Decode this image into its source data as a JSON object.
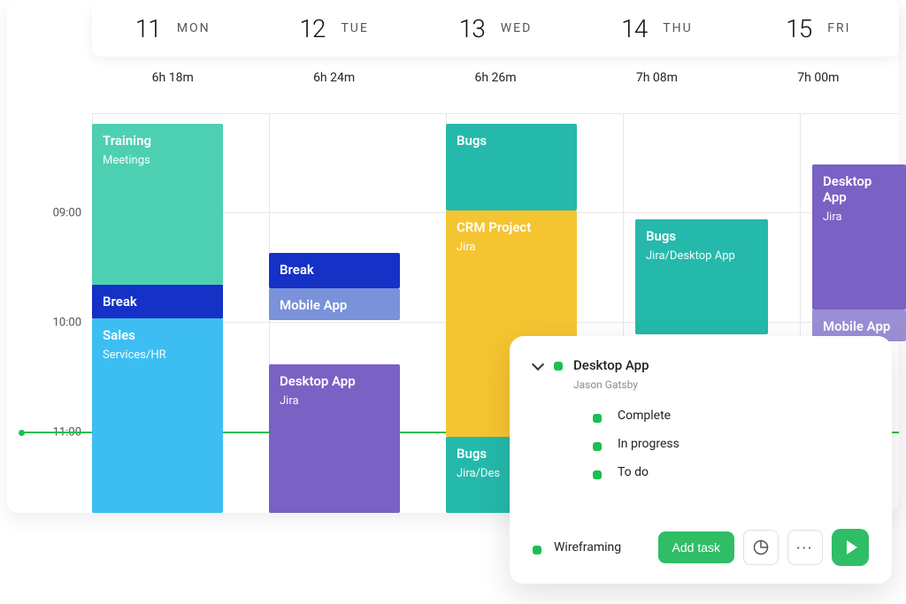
{
  "days": [
    {
      "num": "11",
      "dow": "MON",
      "duration": "6h 18m"
    },
    {
      "num": "12",
      "dow": "TUE",
      "duration": "6h 24m"
    },
    {
      "num": "13",
      "dow": "WED",
      "duration": "6h 26m"
    },
    {
      "num": "14",
      "dow": "THU",
      "duration": "7h 08m"
    },
    {
      "num": "15",
      "dow": "FRI",
      "duration": "7h 00m"
    }
  ],
  "time_labels": {
    "t0900": "09:00",
    "t1000": "10:00",
    "t1100": "11:00"
  },
  "events": {
    "mon_training": {
      "title": "Training",
      "sub": "Meetings"
    },
    "mon_break": {
      "title": "Break"
    },
    "mon_sales": {
      "title": "Sales",
      "sub": "Services/HR"
    },
    "tue_break": {
      "title": "Break"
    },
    "tue_mobile": {
      "title": "Mobile App"
    },
    "tue_desktop": {
      "title": "Desktop App",
      "sub": "Jira"
    },
    "wed_bugs": {
      "title": "Bugs"
    },
    "wed_crm": {
      "title": "CRM Project",
      "sub": "Jira"
    },
    "wed_bugs2": {
      "title": "Bugs",
      "sub": "Jira/Des"
    },
    "thu_bugs": {
      "title": "Bugs",
      "sub": "Jira/Desktop App"
    },
    "fri_desktop": {
      "title": "Desktop App",
      "sub": "Jira"
    },
    "fri_mobile": {
      "title": "Mobile App"
    }
  },
  "popover": {
    "title": "Desktop App",
    "user": "Jason Gatsby",
    "statuses": [
      "Complete",
      "In progress",
      "To do"
    ],
    "current_task": "Wireframing",
    "add_task_label": "Add task"
  },
  "colors": {
    "accent_green": "#2fbd66",
    "now_line": "#1bbf52"
  }
}
